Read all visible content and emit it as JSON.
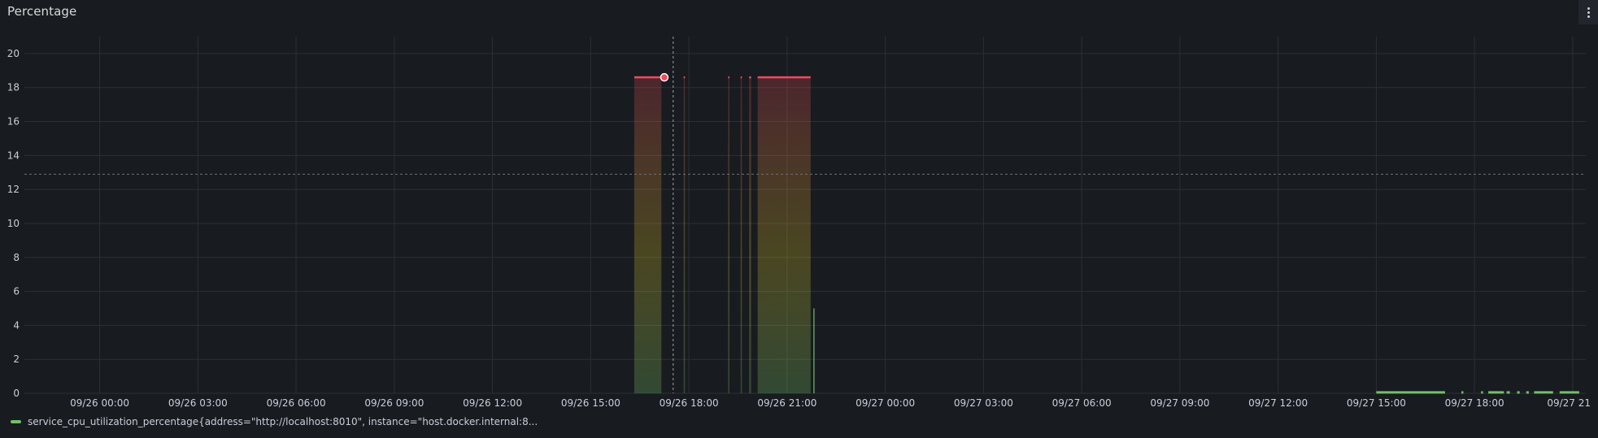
{
  "panel": {
    "title": "Percentage",
    "menu_icon": "kebab-menu-icon"
  },
  "colors": {
    "background": "#181b1f",
    "grid": "#2c3036",
    "series_ok": "#73bf69",
    "series_alert": "#f2495c",
    "threshold_line": "#6e7178",
    "crosshair": "#9fa1a6",
    "text": "#ccccdc"
  },
  "chart_data": {
    "type": "area",
    "ylim": [
      0,
      21
    ],
    "yticks": [
      0,
      2,
      4,
      6,
      8,
      10,
      12,
      14,
      16,
      18,
      20
    ],
    "xticks": [
      {
        "label": "09/26 00:00",
        "hour": 0
      },
      {
        "label": "09/26 03:00",
        "hour": 3
      },
      {
        "label": "09/26 06:00",
        "hour": 6
      },
      {
        "label": "09/26 09:00",
        "hour": 9
      },
      {
        "label": "09/26 12:00",
        "hour": 12
      },
      {
        "label": "09/26 15:00",
        "hour": 15
      },
      {
        "label": "09/26 18:00",
        "hour": 18
      },
      {
        "label": "09/26 21:00",
        "hour": 21
      },
      {
        "label": "09/27 00:00",
        "hour": 24
      },
      {
        "label": "09/27 03:00",
        "hour": 27
      },
      {
        "label": "09/27 06:00",
        "hour": 30
      },
      {
        "label": "09/27 09:00",
        "hour": 33
      },
      {
        "label": "09/27 12:00",
        "hour": 36
      },
      {
        "label": "09/27 15:00",
        "hour": 39
      },
      {
        "label": "09/27 18:00",
        "hour": 42
      },
      {
        "label": "09/27 21",
        "hour": 45
      }
    ],
    "xlim_hours": [
      -2.3,
      45.4
    ],
    "threshold": 12.9,
    "crosshair_hour": 17.52,
    "hover_point": {
      "hour": 17.25,
      "value": 18.6
    },
    "series": [
      {
        "name": "service_cpu_utilization_percentage{address=\"http://localhost:8010\", instance=\"host.docker.internal:8...",
        "segments": [
          {
            "start": 16.33,
            "end": 17.16,
            "value": 18.6
          },
          {
            "start": 17.84,
            "end": 17.88,
            "value": 18.6
          },
          {
            "start": 19.2,
            "end": 19.24,
            "value": 18.6
          },
          {
            "start": 19.58,
            "end": 19.62,
            "value": 18.6
          },
          {
            "start": 19.84,
            "end": 19.9,
            "value": 18.6
          },
          {
            "start": 20.1,
            "end": 21.72,
            "value": 18.6
          },
          {
            "start": 21.82,
            "end": 21.85,
            "value": 5.0
          },
          {
            "start": 39.0,
            "end": 41.1,
            "value": 0.1
          },
          {
            "start": 41.6,
            "end": 41.66,
            "value": 0.1
          },
          {
            "start": 42.2,
            "end": 42.26,
            "value": 0.1
          },
          {
            "start": 42.42,
            "end": 42.9,
            "value": 0.1
          },
          {
            "start": 42.98,
            "end": 43.08,
            "value": 0.1
          },
          {
            "start": 43.3,
            "end": 43.38,
            "value": 0.1
          },
          {
            "start": 43.58,
            "end": 43.66,
            "value": 0.1
          },
          {
            "start": 43.82,
            "end": 44.4,
            "value": 0.1
          },
          {
            "start": 44.6,
            "end": 45.2,
            "value": 0.1
          }
        ]
      }
    ],
    "legend_placement": "bottom-left"
  }
}
